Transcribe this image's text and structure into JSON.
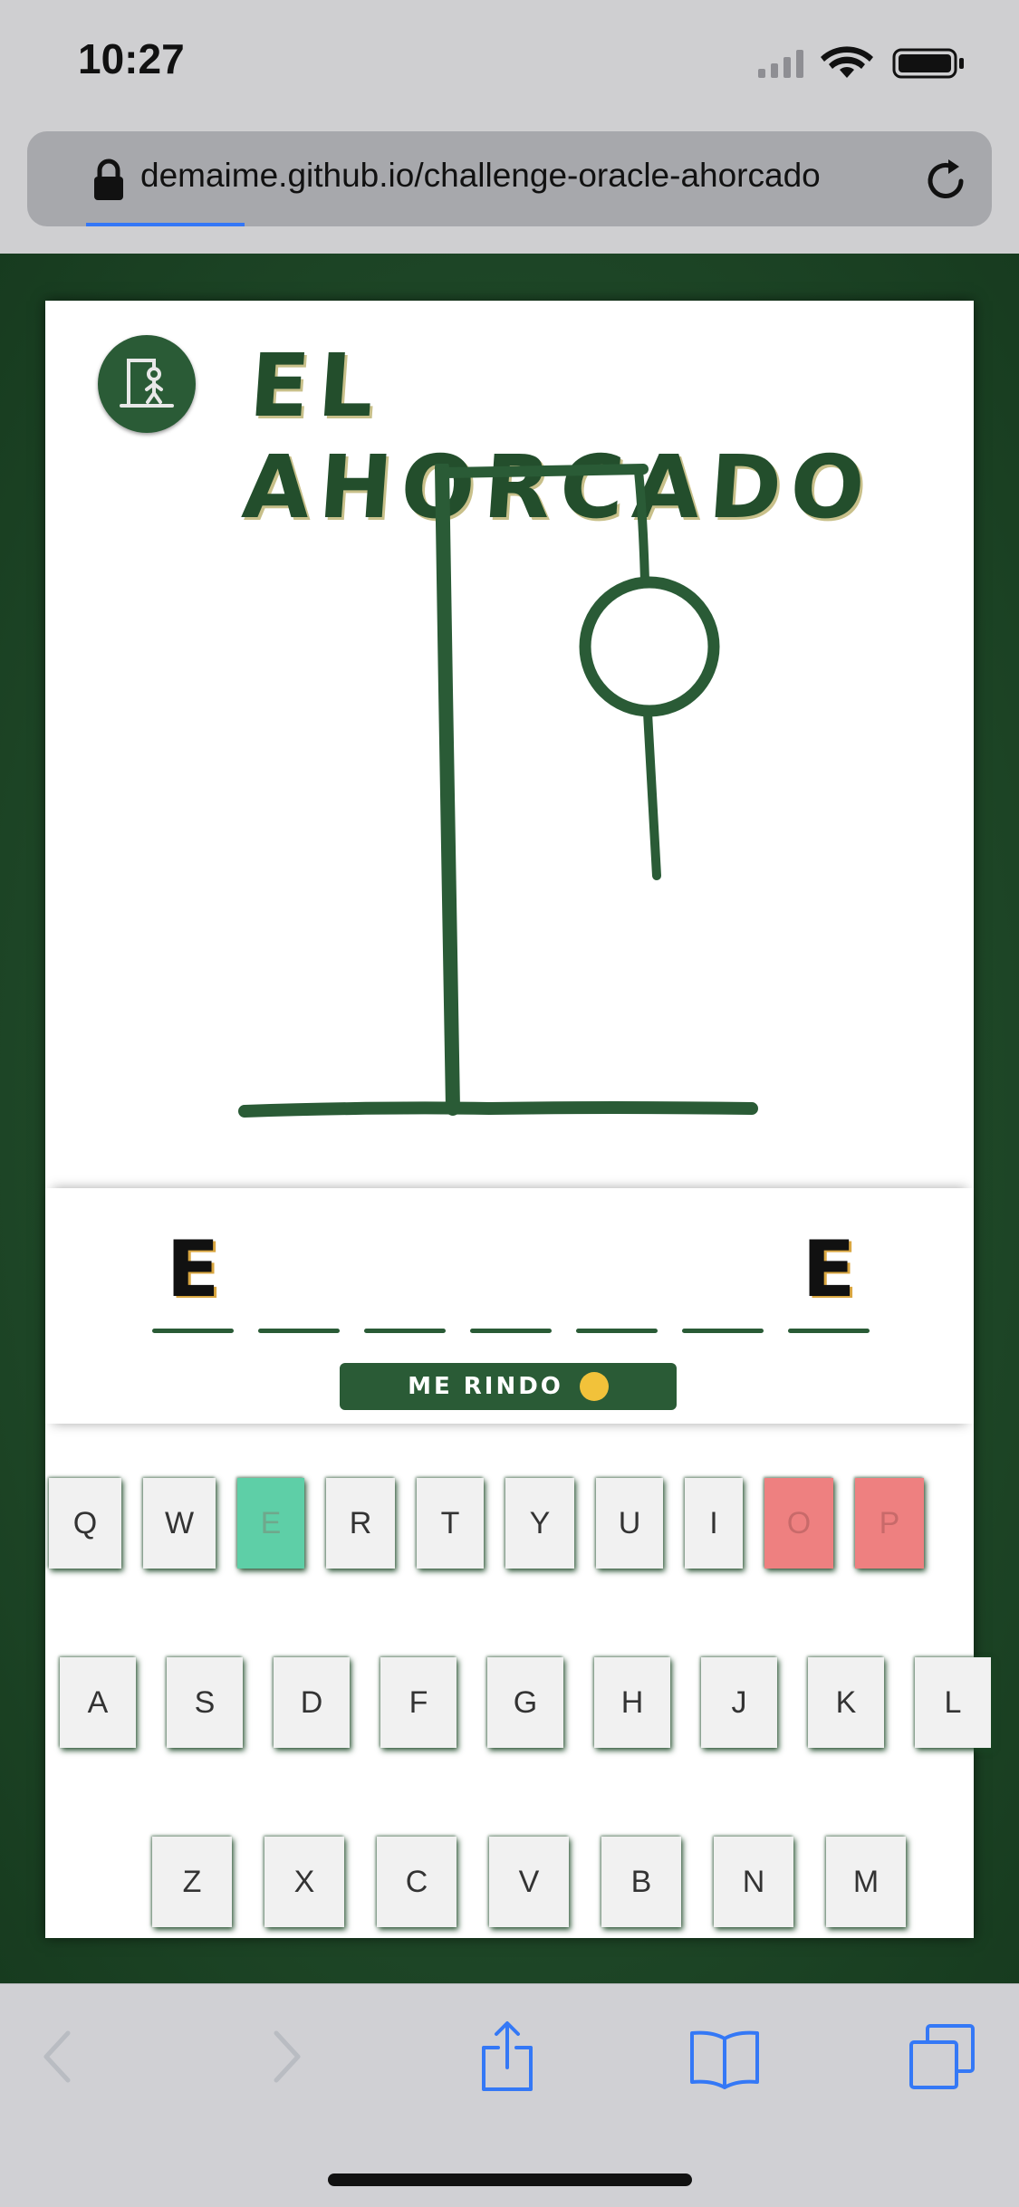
{
  "status": {
    "time": "10:27"
  },
  "browser": {
    "url": "demaime.github.io/challenge-oracle-ahorcado"
  },
  "game": {
    "title": "EL AHORCADO",
    "word_slots": [
      "E",
      "",
      "",
      "",
      "",
      "",
      "E"
    ],
    "giveup_label": "ME RINDO",
    "keyboard": [
      [
        {
          "k": "Q",
          "s": "normal"
        },
        {
          "k": "W",
          "s": "normal"
        },
        {
          "k": "E",
          "s": "correct"
        },
        {
          "k": "R",
          "s": "normal"
        },
        {
          "k": "T",
          "s": "normal"
        },
        {
          "k": "Y",
          "s": "normal"
        },
        {
          "k": "U",
          "s": "normal"
        },
        {
          "k": "I",
          "s": "normal"
        },
        {
          "k": "O",
          "s": "wrong"
        },
        {
          "k": "P",
          "s": "wrong"
        }
      ],
      [
        {
          "k": "A",
          "s": "normal"
        },
        {
          "k": "S",
          "s": "normal"
        },
        {
          "k": "D",
          "s": "normal"
        },
        {
          "k": "F",
          "s": "normal"
        },
        {
          "k": "G",
          "s": "normal"
        },
        {
          "k": "H",
          "s": "normal"
        },
        {
          "k": "J",
          "s": "normal"
        },
        {
          "k": "K",
          "s": "normal"
        },
        {
          "k": "L",
          "s": "normal"
        }
      ],
      [
        {
          "k": "Z",
          "s": "normal"
        },
        {
          "k": "X",
          "s": "normal"
        },
        {
          "k": "C",
          "s": "normal"
        },
        {
          "k": "V",
          "s": "normal"
        },
        {
          "k": "B",
          "s": "normal"
        },
        {
          "k": "N",
          "s": "normal"
        },
        {
          "k": "M",
          "s": "normal"
        }
      ]
    ]
  },
  "toolbar": {
    "icons": [
      "back-icon",
      "forward-icon",
      "share-icon",
      "bookmarks-icon",
      "tabs-icon"
    ]
  },
  "colors": {
    "board": "#204a29",
    "accent": "#2a5b36",
    "correct": "#5ecfa7",
    "wrong": "#ee8080",
    "ios_blue": "#3478f6"
  }
}
